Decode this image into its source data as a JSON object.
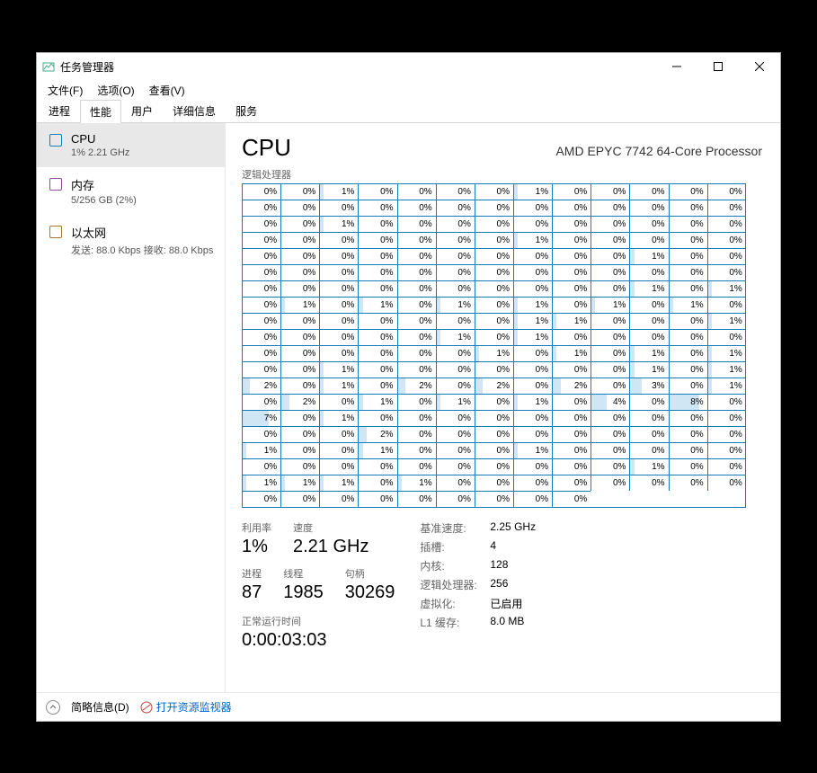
{
  "window": {
    "title": "任务管理器"
  },
  "menu": {
    "file": "文件(F)",
    "options": "选项(O)",
    "view": "查看(V)"
  },
  "tabs": {
    "processes": "进程",
    "performance": "性能",
    "users": "用户",
    "details": "详细信息",
    "services": "服务"
  },
  "sidebar": {
    "cpu": {
      "name": "CPU",
      "sub": "1% 2.21 GHz",
      "color": "#117dbb"
    },
    "memory": {
      "name": "内存",
      "sub": "5/256 GB (2%)",
      "color": "#8b4a9e"
    },
    "ethernet": {
      "name": "以太网",
      "sub": "发送: 88.0 Kbps 接收: 88.0 Kbps",
      "color": "#a37435"
    }
  },
  "main": {
    "title": "CPU",
    "model": "AMD EPYC 7742 64-Core Processor",
    "gridLabel": "逻辑处理器"
  },
  "grid": [
    [
      0,
      0,
      1,
      0,
      0,
      0,
      0,
      1,
      0,
      0,
      0,
      0,
      0
    ],
    [
      0,
      0,
      0,
      0,
      0,
      0,
      0,
      0,
      0,
      0,
      0,
      0,
      0
    ],
    [
      0,
      0,
      1,
      0,
      0,
      0,
      0,
      0,
      0,
      0,
      0,
      0,
      0
    ],
    [
      0,
      0,
      0,
      0,
      0,
      0,
      0,
      1,
      0,
      0,
      0,
      0,
      0
    ],
    [
      0,
      0,
      0,
      0,
      0,
      0,
      0,
      0,
      0,
      0,
      1,
      0,
      0
    ],
    [
      0,
      0,
      0,
      0,
      0,
      0,
      0,
      0,
      0,
      0,
      0,
      0,
      0
    ],
    [
      0,
      0,
      0,
      0,
      0,
      0,
      0,
      0,
      0,
      0,
      1,
      0,
      1
    ],
    [
      0,
      1,
      0,
      1,
      0,
      1,
      0,
      1,
      0,
      1,
      0,
      1,
      0
    ],
    [
      0,
      0,
      0,
      0,
      0,
      0,
      0,
      1,
      1,
      0,
      0,
      0,
      1
    ],
    [
      0,
      0,
      0,
      0,
      0,
      1,
      0,
      1,
      0,
      0,
      0,
      0,
      0
    ],
    [
      0,
      0,
      0,
      0,
      0,
      0,
      1,
      0,
      1,
      0,
      1,
      0,
      1
    ],
    [
      0,
      0,
      1,
      0,
      0,
      0,
      0,
      0,
      0,
      0,
      1,
      0,
      1
    ],
    [
      2,
      0,
      1,
      0,
      2,
      0,
      2,
      0,
      2,
      0,
      3,
      0,
      1
    ],
    [
      0,
      2,
      0,
      1,
      0,
      1,
      0,
      1,
      0,
      4,
      0,
      8,
      0
    ],
    [
      7,
      0,
      1,
      0,
      0,
      0,
      0,
      0,
      0,
      0,
      0,
      0,
      0
    ],
    [
      0,
      0,
      0,
      2,
      0,
      0,
      0,
      0,
      0,
      0,
      0,
      0,
      0
    ],
    [
      1,
      0,
      0,
      1,
      0,
      0,
      0,
      1,
      0,
      0,
      0,
      0,
      0
    ],
    [
      0,
      0,
      0,
      0,
      0,
      0,
      0,
      0,
      0,
      0,
      1,
      0,
      0
    ],
    [
      1,
      1,
      1,
      0,
      1,
      0,
      0,
      0,
      0,
      0,
      0,
      0,
      0
    ],
    [
      0,
      0,
      0,
      0,
      0,
      0,
      0,
      0,
      0
    ]
  ],
  "stats": {
    "utilLabel": "利用率",
    "utilValue": "1%",
    "speedLabel": "速度",
    "speedValue": "2.21 GHz",
    "procLabel": "进程",
    "procValue": "87",
    "threadLabel": "线程",
    "threadValue": "1985",
    "handleLabel": "句柄",
    "handleValue": "30269",
    "uptimeLabel": "正常运行时间",
    "uptimeValue": "0:00:03:03",
    "baseSpeedK": "基准速度:",
    "baseSpeedV": "2.25 GHz",
    "socketsK": "插槽:",
    "socketsV": "4",
    "coresK": "内核:",
    "coresV": "128",
    "lpK": "逻辑处理器:",
    "lpV": "256",
    "virtK": "虚拟化:",
    "virtV": "已启用",
    "l1K": "L1 缓存:",
    "l1V": "8.0 MB"
  },
  "footer": {
    "brief": "简略信息(D)",
    "resmon": "打开资源监视器"
  }
}
